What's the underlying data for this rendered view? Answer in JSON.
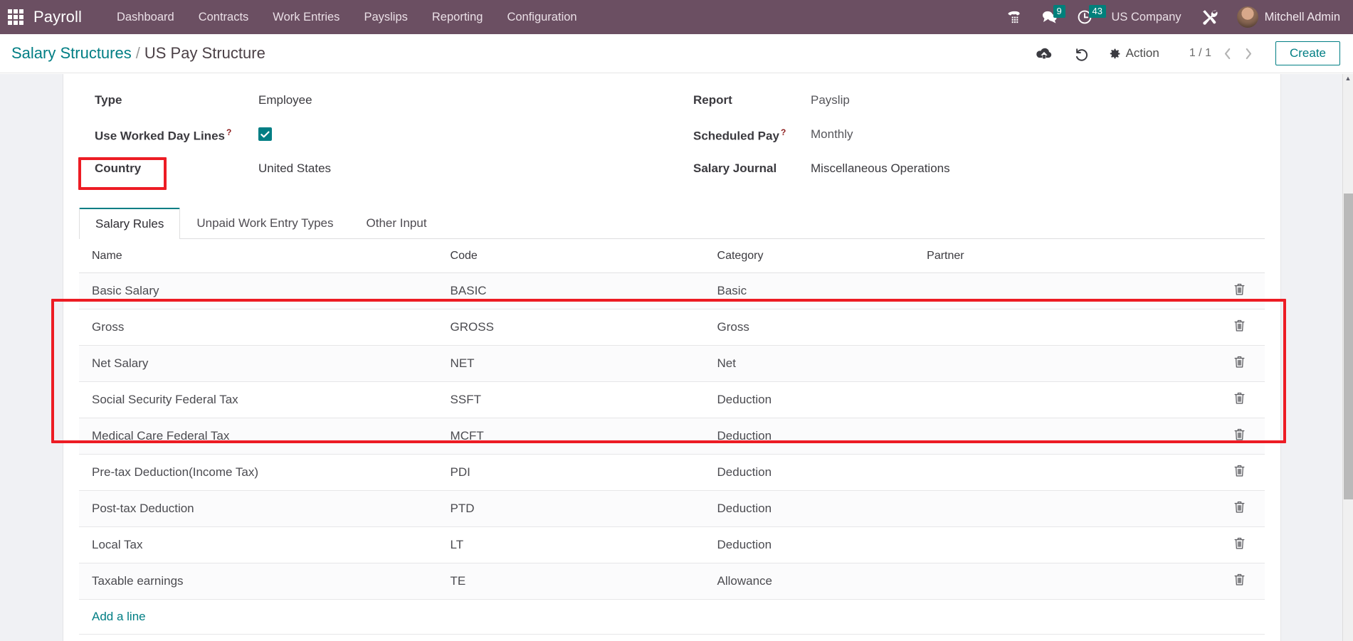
{
  "navbar": {
    "apps_icon": "apps-grid-icon",
    "brand": "Payroll",
    "menu": [
      {
        "label": "Dashboard"
      },
      {
        "label": "Contracts"
      },
      {
        "label": "Work Entries"
      },
      {
        "label": "Payslips"
      },
      {
        "label": "Reporting"
      },
      {
        "label": "Configuration"
      }
    ],
    "phone_icon": "phone-dialpad-icon",
    "messages": {
      "icon": "chat-bubble-icon",
      "count": "9"
    },
    "activities": {
      "icon": "clock-icon",
      "count": "43"
    },
    "company": "US Company",
    "tools_icon": "wrench-screwdriver-icon",
    "user": "Mitchell Admin",
    "accent_bg": "#6b4f62",
    "badge_color": "#00807b"
  },
  "control_panel": {
    "breadcrumb_parent": "Salary Structures",
    "breadcrumb_sep": "/",
    "breadcrumb_current": "US Pay Structure",
    "save_icon": "cloud-upload-icon",
    "discard_icon": "undo-icon",
    "action_icon": "gear-icon",
    "action_label": "Action",
    "pager_value": "1 / 1",
    "pager_prev_icon": "chevron-left-icon",
    "pager_next_icon": "chevron-right-icon",
    "create_label": "Create",
    "accent_color": "#017e84"
  },
  "form": {
    "left": [
      {
        "label": "Type",
        "help": false,
        "value": "Employee",
        "type": "text"
      },
      {
        "label": "Use Worked Day Lines",
        "help": true,
        "value": "checked",
        "type": "checkbox"
      },
      {
        "label": "Country",
        "help": false,
        "value": "United States",
        "type": "text"
      }
    ],
    "right": [
      {
        "label": "Report",
        "help": false,
        "value": "Payslip",
        "type": "text"
      },
      {
        "label": "Scheduled Pay",
        "help": true,
        "value": "Monthly",
        "type": "text"
      },
      {
        "label": "Salary Journal",
        "help": false,
        "value": "Miscellaneous Operations",
        "type": "text"
      }
    ],
    "help_marker": "?"
  },
  "notebook": {
    "tabs": [
      {
        "label": "Salary Rules",
        "active": true
      },
      {
        "label": "Unpaid Work Entry Types",
        "active": false
      },
      {
        "label": "Other Input",
        "active": false
      }
    ]
  },
  "table": {
    "columns": [
      "Name",
      "Code",
      "Category",
      "Partner"
    ],
    "rows": [
      {
        "name": "Basic Salary",
        "code": "BASIC",
        "category": "Basic",
        "partner": "",
        "highlighted": false
      },
      {
        "name": "Gross",
        "code": "GROSS",
        "category": "Gross",
        "partner": "",
        "highlighted": false
      },
      {
        "name": "Net Salary",
        "code": "NET",
        "category": "Net",
        "partner": "",
        "highlighted": false
      },
      {
        "name": "Social Security Federal Tax",
        "code": "SSFT",
        "category": "Deduction",
        "partner": "",
        "highlighted": true
      },
      {
        "name": "Medical Care Federal Tax",
        "code": "MCFT",
        "category": "Deduction",
        "partner": "",
        "highlighted": true
      },
      {
        "name": "Pre-tax Deduction(Income Tax)",
        "code": "PDI",
        "category": "Deduction",
        "partner": "",
        "highlighted": true
      },
      {
        "name": "Post-tax Deduction",
        "code": "PTD",
        "category": "Deduction",
        "partner": "",
        "highlighted": true
      },
      {
        "name": "Local Tax",
        "code": "LT",
        "category": "Deduction",
        "partner": "",
        "highlighted": true
      },
      {
        "name": "Taxable earnings",
        "code": "TE",
        "category": "Allowance",
        "partner": "",
        "highlighted": false
      }
    ],
    "delete_icon": "trash-icon",
    "add_line_label": "Add a line"
  },
  "annotations": {
    "color": "#ed1c24",
    "boxes": [
      {
        "name": "salary-rules-tab-highlight"
      },
      {
        "name": "deduction-rows-highlight"
      }
    ]
  }
}
